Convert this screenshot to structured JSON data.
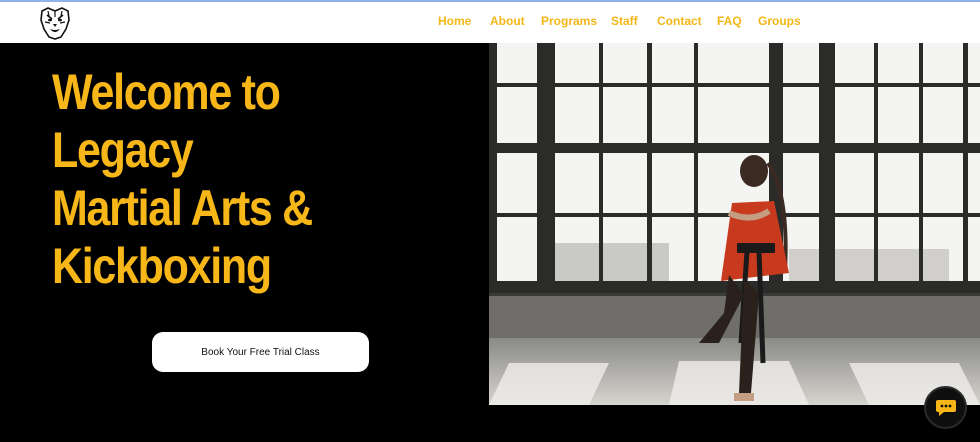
{
  "header": {
    "logo_icon": "tiger-head-icon",
    "nav": [
      {
        "label": "Home"
      },
      {
        "label": "About"
      },
      {
        "label": "Programs"
      },
      {
        "label": "Staff"
      },
      {
        "label": "Contact"
      },
      {
        "label": "FAQ"
      },
      {
        "label": "Groups"
      }
    ]
  },
  "hero": {
    "headline_lines": [
      "Welcome to",
      "Legacy",
      "Martial Arts &",
      "Kickboxing"
    ],
    "cta_label": "Book Your Free Trial Class",
    "image_subject": "girl in red martial arts uniform in front of large windows"
  },
  "chat": {
    "icon": "chat-bubble-icon"
  },
  "colors": {
    "accent": "#f7b718",
    "background": "#000000",
    "header": "#ffffff"
  }
}
